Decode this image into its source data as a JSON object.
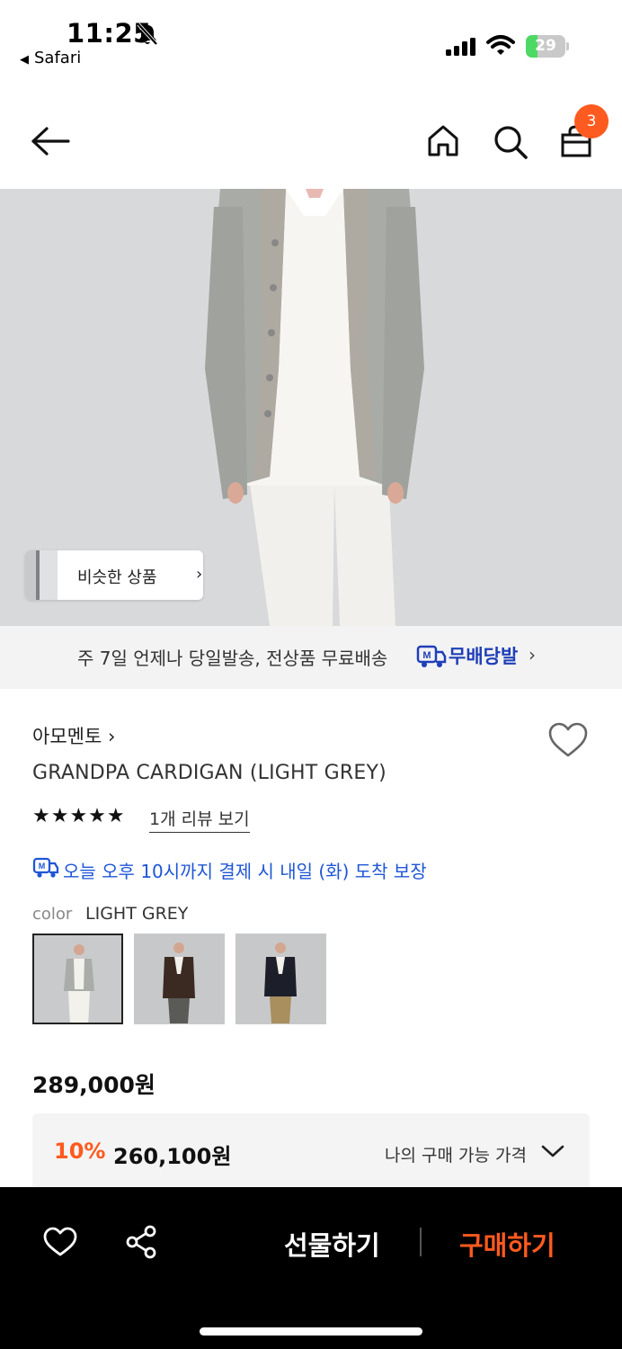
{
  "status_bar": {
    "time": "11:25",
    "back_app": "Safari",
    "battery": "29",
    "battery_level": 0.29
  },
  "nav": {
    "cart_count": "3"
  },
  "hero": {
    "similar_label": "비슷한 상품"
  },
  "delivery_banner": {
    "text": "주 7일 언제나 당일발송, 전상품 무료배송",
    "brand": "무배당발"
  },
  "product": {
    "brand": "아모멘토",
    "name": "GRANDPA CARDIGAN (LIGHT GREY)",
    "stars": "★★★★★",
    "rating": 5,
    "review_link": "1개 리뷰 보기",
    "arrival_notice": "오늘 오후 10시까지 결제 시 내일 (화) 도착 보장",
    "color_key": "color",
    "color_value": "LIGHT GREY",
    "price": "289,000원",
    "discount_percent": "10%",
    "discount_price": "260,100원",
    "my_price_label": "나의 구매 가능 가격"
  },
  "bottom_bar": {
    "gift_label": "선물하기",
    "buy_label": "구매하기"
  },
  "colors": {
    "accent": "#ff5a1f",
    "link_blue": "#1f56d6",
    "mu_blue": "#1f3fb8"
  }
}
